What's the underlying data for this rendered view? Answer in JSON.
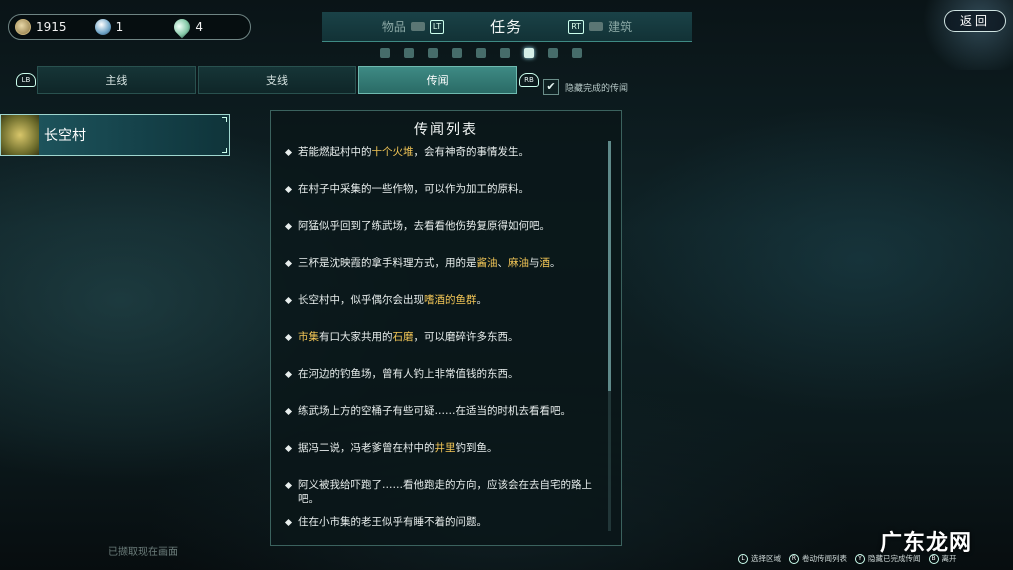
{
  "currency": [
    {
      "icon": "coin-icon",
      "value": "1915"
    },
    {
      "icon": "orb-icon",
      "value": "1"
    },
    {
      "icon": "droplet-icon",
      "value": "4"
    }
  ],
  "top_tabs": {
    "left": "物品",
    "left_key": "LT",
    "center": "任务",
    "right_key": "RT",
    "right": "建筑"
  },
  "return_label": "返回",
  "sub_tabs": {
    "left_key": "LB",
    "right_key": "RB",
    "items": [
      "主线",
      "支线",
      "传闻"
    ],
    "active_index": 2
  },
  "hide_completed": {
    "label": "隐藏完成的传闻",
    "checked": true,
    "check_glyph": "✔"
  },
  "location": {
    "name": "长空村"
  },
  "rumor_panel": {
    "title": "传闻列表",
    "entries": [
      {
        "segments": [
          {
            "t": "若能燃起村中的"
          },
          {
            "t": "十个火堆",
            "hl": true
          },
          {
            "t": "，会有神奇的事情发生。"
          }
        ]
      },
      {
        "segments": [
          {
            "t": "在村子中采集的一些作物，可以作为加工的原料。"
          }
        ]
      },
      {
        "segments": [
          {
            "t": "阿猛似乎回到了练武场，去看看他伤势复原得如何吧。"
          }
        ]
      },
      {
        "segments": [
          {
            "t": "三杯是沈映霞的拿手料理方式，用的是"
          },
          {
            "t": "酱油",
            "hl": true
          },
          {
            "t": "、"
          },
          {
            "t": "麻油",
            "hl": true
          },
          {
            "t": "与"
          },
          {
            "t": "酒",
            "hl": true
          },
          {
            "t": "。"
          }
        ]
      },
      {
        "segments": [
          {
            "t": "长空村中，似乎偶尔会出现"
          },
          {
            "t": "嗜酒的鱼群",
            "hl": true
          },
          {
            "t": "。"
          }
        ]
      },
      {
        "segments": [
          {
            "t": "市集",
            "hl": true
          },
          {
            "t": "有口大家共用的"
          },
          {
            "t": "石磨",
            "hl": true
          },
          {
            "t": "，可以磨碎许多东西。"
          }
        ]
      },
      {
        "segments": [
          {
            "t": "在河边的钓鱼场，曾有人钓上非常值钱的东西。"
          }
        ]
      },
      {
        "segments": [
          {
            "t": "练武场上方的空桶子有些可疑……在适当的时机去看看吧。"
          }
        ]
      },
      {
        "segments": [
          {
            "t": "据冯二说，冯老爹曾在村中的"
          },
          {
            "t": "井里",
            "hl": true
          },
          {
            "t": "钓到鱼。"
          }
        ]
      },
      {
        "segments": [
          {
            "t": "阿义被我给吓跑了……看他跑走的方向，应该会在去自宅的路上吧。"
          }
        ]
      },
      {
        "segments": [
          {
            "t": "住在小市集的老王似乎有睡不着的问题。"
          }
        ]
      }
    ]
  },
  "screenshot_note": "已撷取现在画面",
  "hints": [
    {
      "key": "L",
      "label": "选择区域"
    },
    {
      "key": "R",
      "label": "卷动传闻列表"
    },
    {
      "key": "Y",
      "label": "隐藏已完成传闻"
    },
    {
      "key": "B",
      "label": "离开"
    }
  ],
  "watermark": "广东龙网",
  "colors": {
    "highlight": "#f1c556",
    "accent": "#3e8a84"
  }
}
